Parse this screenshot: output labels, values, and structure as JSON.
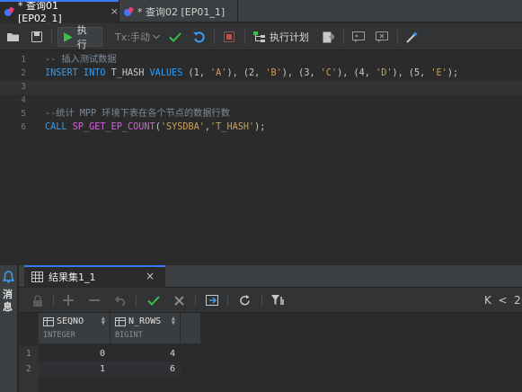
{
  "tabs": [
    {
      "label": "* 查询01 [EP02_1]",
      "close": "×",
      "active": true
    },
    {
      "label": "* 查询02 [EP01_1]",
      "active": false
    }
  ],
  "toolbar": {
    "run_label": "执行",
    "tx_mode": "Tx:手动",
    "plan_label": "执行计划"
  },
  "editor": {
    "lines": [
      {
        "num": "1",
        "tokens": [
          {
            "t": "-- 插入测试数据",
            "c": "cmt"
          }
        ]
      },
      {
        "num": "2",
        "tokens": [
          {
            "t": "INSERT INTO ",
            "c": "kw"
          },
          {
            "t": "T_HASH ",
            "c": ""
          },
          {
            "t": "VALUES ",
            "c": "kw"
          },
          {
            "t": "(1, ",
            "c": ""
          },
          {
            "t": "'A'",
            "c": "str"
          },
          {
            "t": "), (2, ",
            "c": ""
          },
          {
            "t": "'B'",
            "c": "str"
          },
          {
            "t": "), (3, ",
            "c": ""
          },
          {
            "t": "'C'",
            "c": "str"
          },
          {
            "t": "), (4, ",
            "c": ""
          },
          {
            "t": "'D'",
            "c": "str"
          },
          {
            "t": "), (5, ",
            "c": ""
          },
          {
            "t": "'E'",
            "c": "str"
          },
          {
            "t": ");",
            "c": ""
          }
        ]
      },
      {
        "num": "3",
        "tokens": [],
        "current": true
      },
      {
        "num": "4",
        "tokens": []
      },
      {
        "num": "5",
        "tokens": [
          {
            "t": "--统计 MPP 环境下表在各个节点的数据行数",
            "c": "cmt"
          }
        ]
      },
      {
        "num": "6",
        "tokens": [
          {
            "t": "CALL ",
            "c": "kw"
          },
          {
            "t": "SP_GET_EP_COUNT",
            "c": "fn"
          },
          {
            "t": "(",
            "c": ""
          },
          {
            "t": "'SYSDBA'",
            "c": "str"
          },
          {
            "t": ",",
            "c": ""
          },
          {
            "t": "'T_HASH'",
            "c": "str"
          },
          {
            "t": ");",
            "c": ""
          }
        ]
      }
    ]
  },
  "messages_label": "消息",
  "result": {
    "tab_label": "结果集1_1",
    "tab_close": "×",
    "nav_text": "K  <  2",
    "columns": [
      {
        "name": "SEQNO",
        "type": "INTEGER"
      },
      {
        "name": "N_ROWS",
        "type": "BIGINT"
      }
    ],
    "rows": [
      {
        "num": "1",
        "cells": [
          "0",
          "4"
        ]
      },
      {
        "num": "2",
        "cells": [
          "1",
          "6"
        ]
      }
    ]
  },
  "colors": {
    "accent": "#3b78ff",
    "keyword": "#2f9df4",
    "string": "#c6a05a",
    "comment": "#7b8a9b",
    "function": "#d55fde",
    "run_green": "#3bbf4a"
  }
}
